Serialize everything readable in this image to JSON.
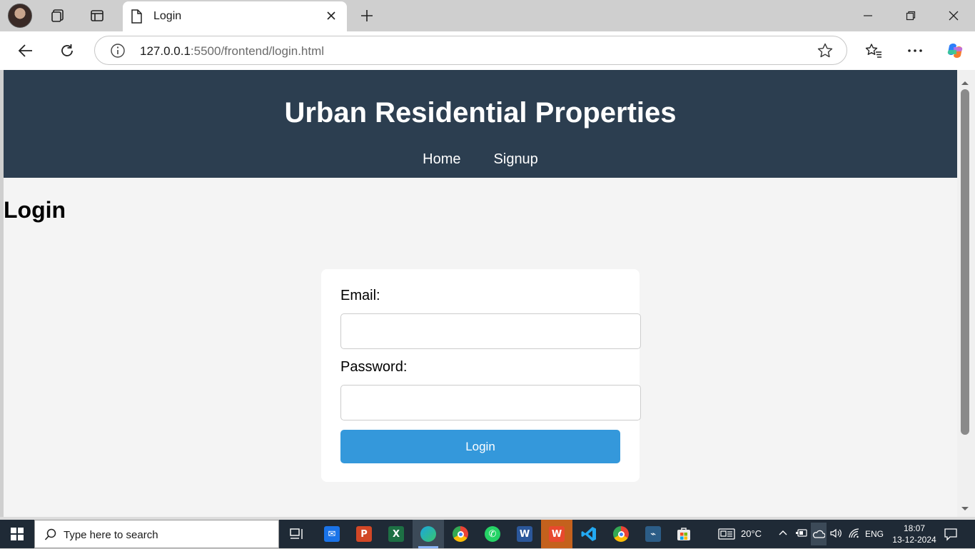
{
  "browser": {
    "tab_title": "Login",
    "url_host": "127.0.0.1",
    "url_path": ":5500/frontend/login.html"
  },
  "site": {
    "title": "Urban Residential Properties",
    "nav": [
      "Home",
      "Signup"
    ],
    "page_heading": "Login",
    "form": {
      "email_label": "Email:",
      "email_value": "",
      "password_label": "Password:",
      "password_value": "",
      "submit_label": "Login"
    }
  },
  "taskbar": {
    "search_placeholder": "Type here to search",
    "weather": "20°C",
    "language": "ENG",
    "time": "18:07",
    "date": "13-12-2024"
  },
  "colors": {
    "header_bg": "#2c3e50",
    "button_bg": "#3498db",
    "page_bg": "#f4f4f4"
  }
}
